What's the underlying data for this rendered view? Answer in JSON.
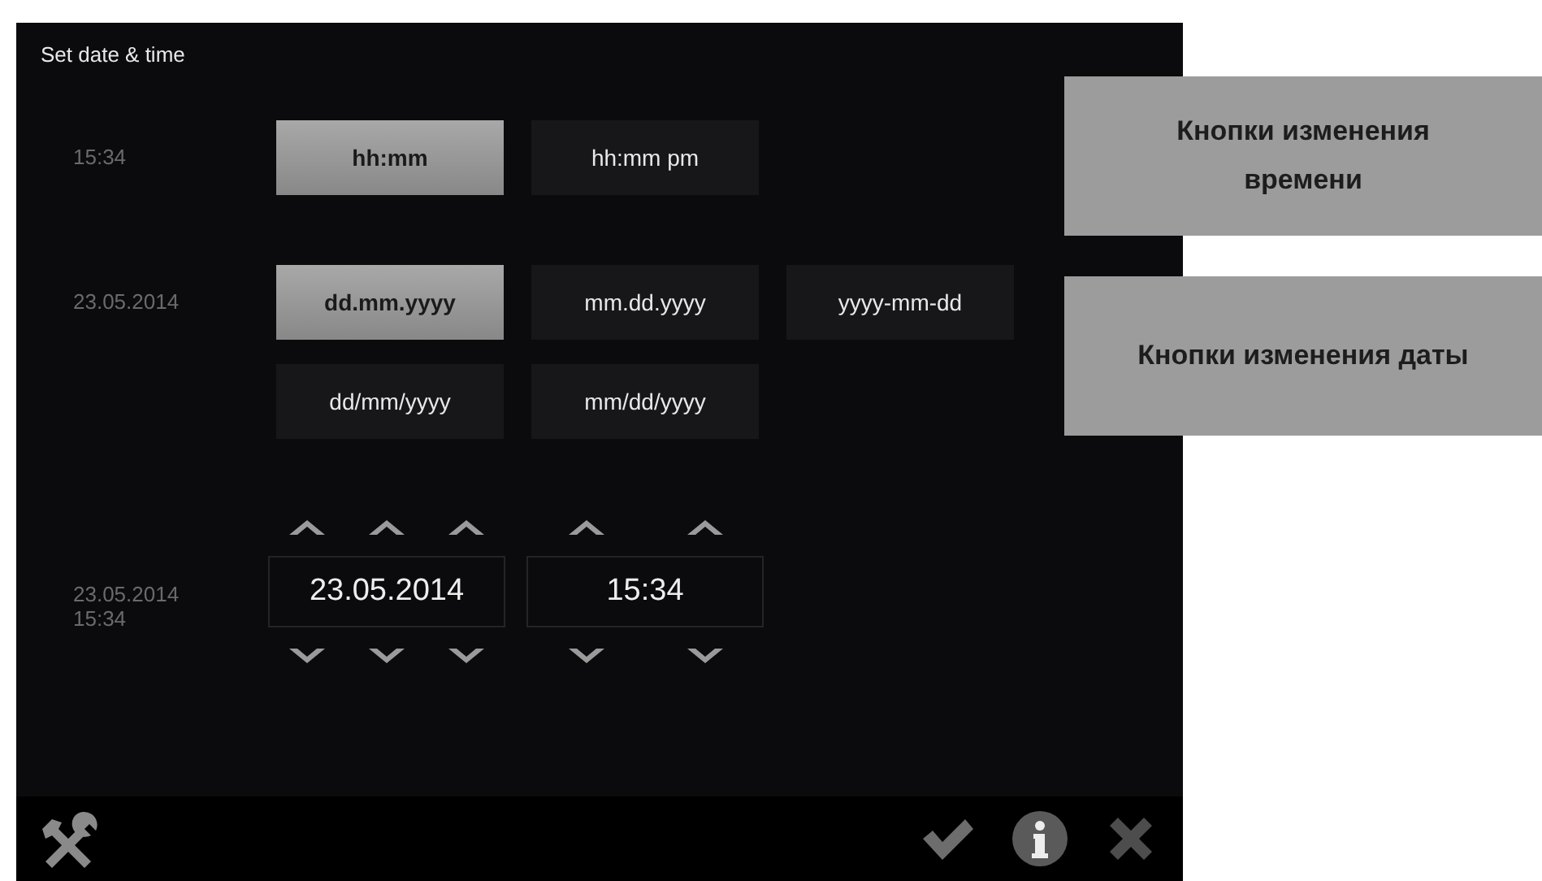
{
  "window": {
    "title": "Set date & time"
  },
  "time_format": {
    "current": "15:34",
    "options": [
      {
        "label": "hh:mm",
        "selected": true
      },
      {
        "label": "hh:mm pm",
        "selected": false
      }
    ]
  },
  "date_format": {
    "current": "23.05.2014",
    "options": [
      {
        "label": "dd.mm.yyyy",
        "selected": true
      },
      {
        "label": "mm.dd.yyyy",
        "selected": false
      },
      {
        "label": "yyyy-mm-dd",
        "selected": false
      },
      {
        "label": "dd/mm/yyyy",
        "selected": false
      },
      {
        "label": "mm/dd/yyyy",
        "selected": false
      }
    ]
  },
  "editor": {
    "current": [
      "23.05.2014",
      "15:34"
    ],
    "fields": [
      {
        "kind": "date",
        "value": "23.05.2014"
      },
      {
        "kind": "time",
        "value": "15:34"
      }
    ]
  },
  "annotations": [
    "Кнопки изменения времени",
    "Кнопки изменения даты"
  ]
}
